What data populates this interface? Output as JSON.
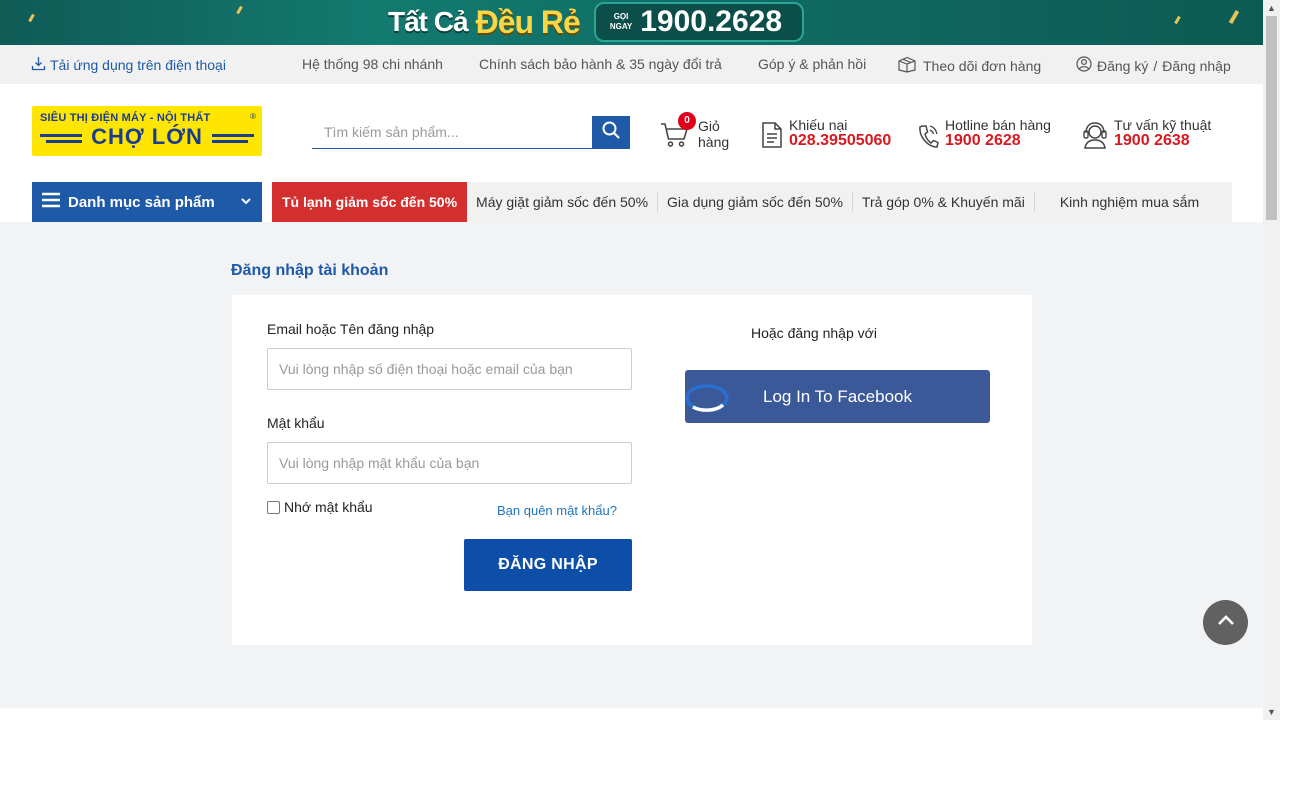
{
  "banner": {
    "text_a": "Tất Cả",
    "text_b": "Đều Rẻ",
    "call_label_1": "GỌI",
    "call_label_2": "NGAY",
    "phone": "1900.2628"
  },
  "toplinks": {
    "app": "Tải ứng dụng trên điện thoại",
    "branches": "Hệ thống 98 chi nhánh",
    "warranty": "Chính sách bảo hành & 35 ngày đổi trả",
    "feedback": "Góp ý & phản hồi",
    "track": "Theo dõi đơn hàng",
    "register": "Đăng ký",
    "separator": "/",
    "login": "Đăng nhập"
  },
  "header": {
    "logo_line1": "SIÊU THỊ ĐIỆN MÁY - NỘI THẤT",
    "logo_line2": "CHỢ LỚN",
    "logo_mark": "®",
    "search_placeholder": "Tìm kiếm sản phẩm...",
    "cart_count": "0",
    "cart_label_1": "Giỏ",
    "cart_label_2": "hàng",
    "complaint_label": "Khiếu nại",
    "complaint_phone": "028.39505060",
    "hotline_label": "Hotline bán hàng",
    "hotline_phone": "1900 2628",
    "tech_label": "Tư vấn kỹ thuật",
    "tech_phone": "1900 2638"
  },
  "nav": {
    "category": "Danh mục sản phẩm",
    "hot": "Tủ lạnh giảm sốc đến 50%",
    "items": [
      "Máy giặt giảm sốc đến 50%",
      "Gia dụng giảm sốc đến 50%",
      "Trả góp 0% & Khuyến mãi"
    ],
    "last": "Kinh nghiệm mua sắm"
  },
  "login": {
    "title": "Đăng nhập tài khoản",
    "email_label": "Email hoặc Tên đăng nhập",
    "email_placeholder": "Vui lòng nhập số điện thoại hoặc email của bạn",
    "password_label": "Mật khẩu",
    "password_placeholder": "Vui lòng nhập mật khẩu của bạn",
    "remember": "Nhớ mật khẩu",
    "forgot": "Bạn quên mật khẩu?",
    "submit": "ĐĂNG NHẬP",
    "or_text": "Hoặc đăng nhập với",
    "facebook": "Log In To Facebook"
  },
  "colors": {
    "brand_blue": "#1e5aa8",
    "hot_red": "#d32f2f",
    "facebook": "#3b5998",
    "phone_red": "#d71920"
  },
  "icons": [
    "download-icon",
    "box-icon",
    "user-circle-icon",
    "search-icon",
    "cart-icon",
    "document-icon",
    "phone-icon",
    "headset-icon",
    "menu-icon",
    "chevron-down-icon",
    "loading-spinner-icon",
    "chevron-up-icon"
  ]
}
